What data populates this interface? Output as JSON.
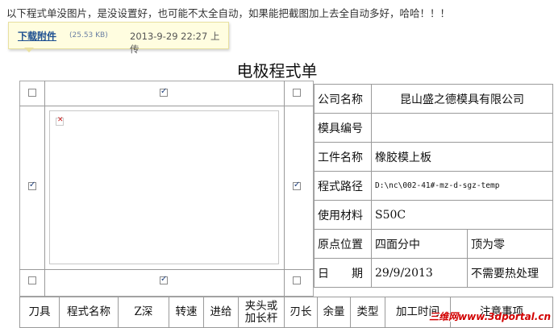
{
  "intro_text": "以下程式单没图片，是没设置好，也可能不太全自动，如果能把截图加上去全自动多好，哈哈！！！",
  "attachment": {
    "link_label": "下载附件",
    "size": "(25.53 KB)",
    "date": "2013-9-29 22:27 上传"
  },
  "title": "电极程式单",
  "info_rows": [
    {
      "label": "公司名称",
      "value": "昆山盛之德模具有限公司",
      "extra": ""
    },
    {
      "label": "模具编号",
      "value": "",
      "extra": ""
    },
    {
      "label": "工件名称",
      "value": "橡胶模上板",
      "extra": ""
    },
    {
      "label": "程式路径",
      "value": "D:\\nc\\002-41#-mz-d-sgz-temp",
      "extra": ""
    },
    {
      "label": "使用材料",
      "value": "S50C",
      "extra": ""
    },
    {
      "label": "原点位置",
      "value": "四面分中",
      "extra": "顶为零"
    },
    {
      "label": "日　　期",
      "value": "29/9/2013",
      "extra": "不需要热处理"
    }
  ],
  "columns": [
    "刀具",
    "程式名称",
    "Z深",
    "转速",
    "进给",
    "夹头或加长杆",
    "刃长",
    "余量",
    "类型",
    "加工时间",
    "注意事项"
  ],
  "checkboxes": {
    "top_left": false,
    "top_middle": true,
    "top_right": false,
    "mid_left": true,
    "mid_right": true,
    "bottom_left": false,
    "bottom_middle": true,
    "bottom_right": false
  },
  "watermark": "三维网www.3dportal.cn"
}
